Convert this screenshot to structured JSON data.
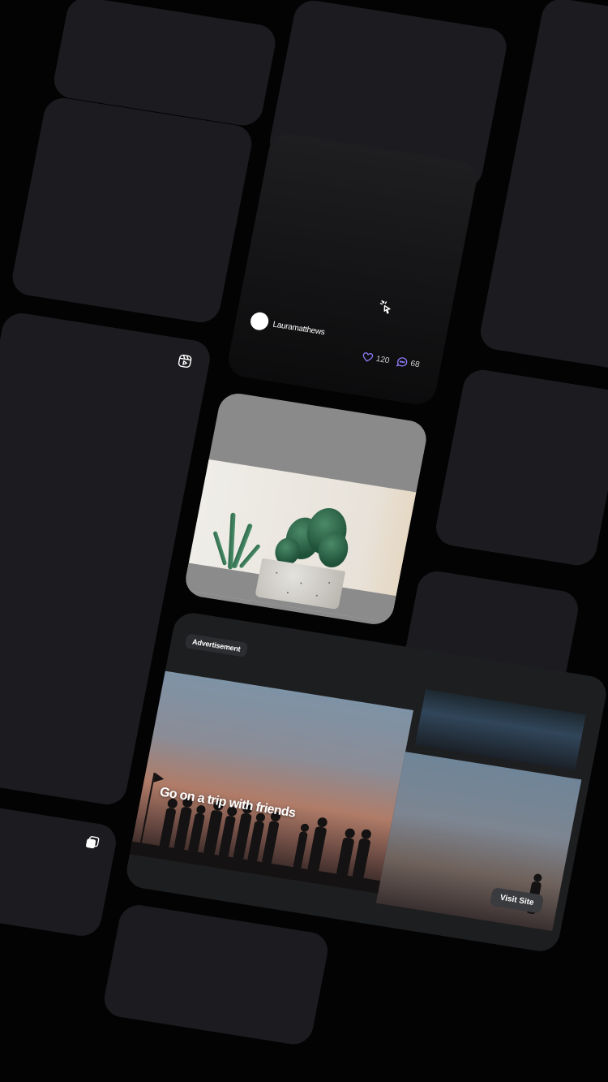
{
  "post": {
    "username": "Lauramatthews",
    "likes": "120",
    "comments": "68",
    "cursor_icon": "cursor-click-icon",
    "like_icon": "heart-icon",
    "comment_icon": "comment-icon"
  },
  "reel": {
    "icon": "reels-icon"
  },
  "carousel": {
    "icon": "layers-icon"
  },
  "photo": {
    "subject": "cactus-plant-photo"
  },
  "ad": {
    "tag": "Advertisement",
    "headline": "Go on a trip with friends",
    "cta": "Visit Site"
  },
  "colors": {
    "background": "#030303",
    "card": "#1c1c20",
    "accent": "#8b7cf6"
  }
}
